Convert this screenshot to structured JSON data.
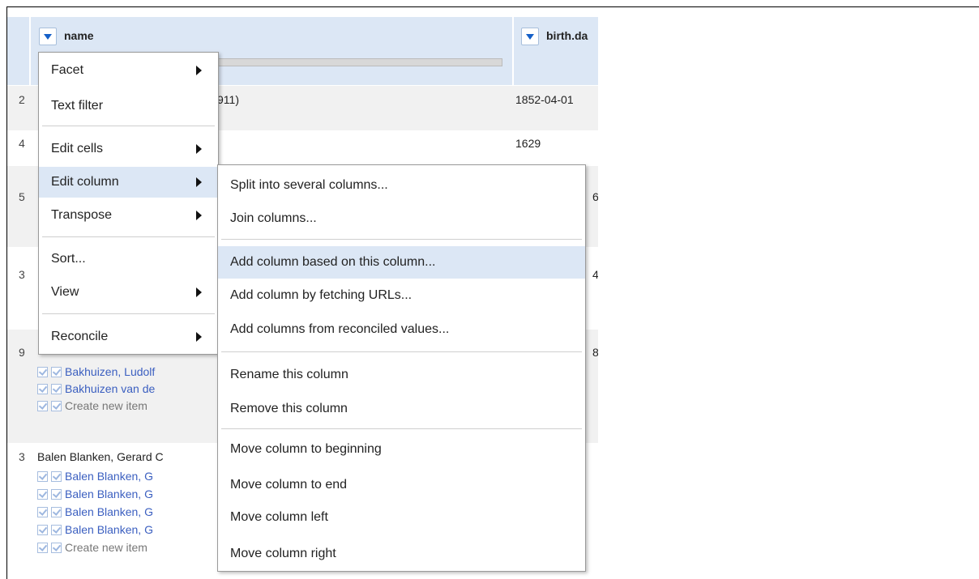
{
  "columns": {
    "name": "name",
    "birth": "birth.da"
  },
  "rows": [
    {
      "num": "2",
      "name_tail": "911)",
      "birth": "1852-04-01"
    },
    {
      "num": "4",
      "birth": "1629"
    },
    {
      "num": "5",
      "birth_tail": "6"
    },
    {
      "num": "3",
      "birth_tail": "4"
    },
    {
      "num": "9",
      "birth_tail": "8",
      "candidates": [
        "Bakhuizen, Ludolf",
        "Bakhuizen van de",
        "Create new item"
      ]
    },
    {
      "num": "3",
      "name": "Balen Blanken, Gerard C",
      "candidates": [
        "Balen Blanken, G",
        "Balen Blanken, G",
        "Balen Blanken, G",
        "Balen Blanken, G",
        "Create new item"
      ]
    }
  ],
  "main_menu": {
    "items": [
      {
        "label": "Facet",
        "submenu": true
      },
      {
        "label": "Text filter",
        "submenu": false
      },
      {
        "label": "Edit cells",
        "submenu": true
      },
      {
        "label": "Edit column",
        "submenu": true
      },
      {
        "label": "Transpose",
        "submenu": true
      },
      {
        "label": "Sort...",
        "submenu": false
      },
      {
        "label": "View",
        "submenu": true
      },
      {
        "label": "Reconcile",
        "submenu": true
      }
    ]
  },
  "sub_menu": {
    "items": [
      {
        "label": "Split into several columns..."
      },
      {
        "label": "Join columns..."
      },
      {
        "label": "Add column based on this column..."
      },
      {
        "label": "Add column by fetching URLs..."
      },
      {
        "label": "Add columns from reconciled values..."
      },
      {
        "label": "Rename this column"
      },
      {
        "label": "Remove this column"
      },
      {
        "label": "Move column to beginning"
      },
      {
        "label": "Move column to end"
      },
      {
        "label": "Move column left"
      },
      {
        "label": "Move column right"
      }
    ]
  },
  "icons": {
    "dropdown": "dropdown-arrow-icon",
    "submenu": "submenu-arrow-icon",
    "check": "check-icon"
  },
  "colors": {
    "header": "#dce7f5",
    "highlight": "#dce7f5",
    "link": "#3b5fc0"
  }
}
